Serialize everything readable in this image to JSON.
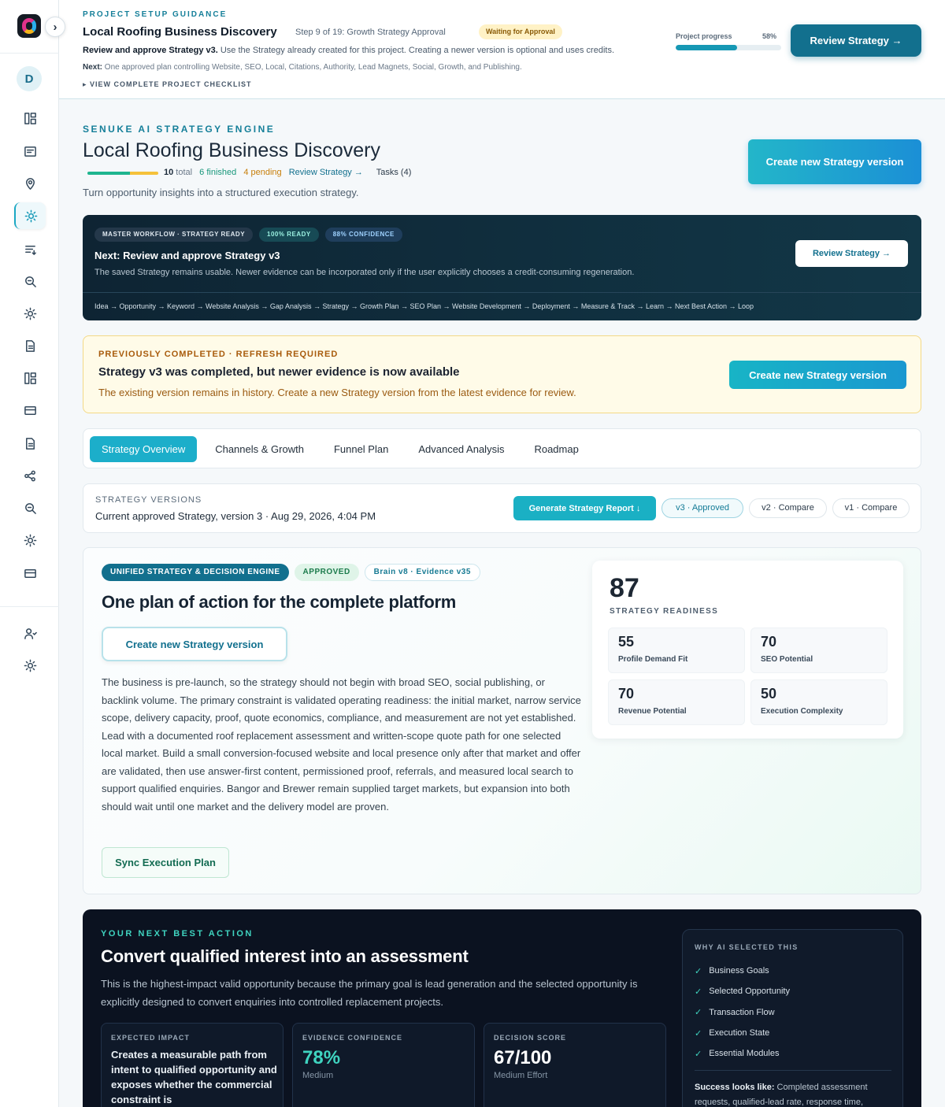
{
  "sidebar": {
    "avatar_initial": "D",
    "collapse_icon": "chevron-right-icon",
    "nav_icons": [
      "dashboard-icon",
      "card-icon",
      "location-pin-icon",
      "sun-icon",
      "list-filter-icon",
      "search-zoom-icon",
      "sun-icon",
      "document-icon",
      "dashboard-icon",
      "credit-card-icon",
      "document-icon",
      "share-nodes-icon",
      "search-zoom-icon",
      "sun-icon",
      "credit-card-icon",
      "users-icon",
      "sun-icon"
    ],
    "active_index": 3
  },
  "topbar": {
    "eyebrow": "PROJECT SETUP GUIDANCE",
    "title": "Local Roofing Business Discovery",
    "step": "Step 9 of 19: Growth Strategy Approval",
    "badge": "Waiting for Approval",
    "desc_bold": "Review and approve Strategy v3.",
    "desc_rest": " Use the Strategy already created for this project. Creating a newer version is optional and uses credits.",
    "next_label": "Next:",
    "next_text": " One approved plan controlling Website, SEO, Local, Citations, Authority, Lead Magnets, Social, Growth, and Publishing.",
    "checklist": "▸ VIEW COMPLETE PROJECT CHECKLIST",
    "progress_label": "Project progress",
    "progress_value": "58%",
    "progress_fraction": 0.58,
    "review_button": "Review Strategy →"
  },
  "header": {
    "eyebrow": "SENUKE AI STRATEGY ENGINE",
    "title": "Local Roofing Business Discovery",
    "total_num": "10",
    "total_label": " total",
    "finished": "6 finished",
    "pending": "4 pending",
    "review_link": "Review Strategy →",
    "tasks": "Tasks (4)",
    "subtitle": "Turn opportunity insights into a structured execution strategy.",
    "create_button": "Create new Strategy version"
  },
  "workflow": {
    "chips": [
      "MASTER WORKFLOW · STRATEGY READY",
      "100% READY",
      "88% CONFIDENCE"
    ],
    "title": "Next: Review and approve Strategy v3",
    "desc": "The saved Strategy remains usable. Newer evidence can be incorporated only if the user explicitly chooses a credit-consuming regeneration.",
    "path": "Idea → Opportunity → Keyword → Website Analysis → Gap Analysis → Strategy → Growth Plan → SEO Plan → Website Development → Deployment → Measure & Track → Learn → Next Best Action → Loop",
    "review_button": "Review Strategy →"
  },
  "refresh": {
    "eyebrow": "PREVIOUSLY COMPLETED · REFRESH REQUIRED",
    "title": "Strategy v3 was completed, but newer evidence is now available",
    "desc": "The existing version remains in history. Create a new Strategy version from the latest evidence for review.",
    "button": "Create new Strategy version"
  },
  "tabs": [
    "Strategy Overview",
    "Channels & Growth",
    "Funnel Plan",
    "Advanced Analysis",
    "Roadmap"
  ],
  "versions": {
    "eyebrow": "STRATEGY VERSIONS",
    "current": "Current approved Strategy, version 3 · Aug 29, 2026, 4:04 PM",
    "generate_button": "Generate Strategy Report ↓",
    "v3": "v3 · Approved",
    "v2": "v2 · Compare",
    "v1": "v1 · Compare"
  },
  "strategy": {
    "chips": [
      "UNIFIED STRATEGY & DECISION ENGINE",
      "APPROVED",
      "Brain v8 · Evidence v35"
    ],
    "title": "One plan of action for the complete platform",
    "create_button": "Create new Strategy version",
    "paragraph": "The business is pre-launch, so the strategy should not begin with broad SEO, social publishing, or backlink volume. The primary constraint is validated operating readiness: the initial market, narrow service scope, delivery capacity, proof, quote economics, compliance, and measurement are not yet established. Lead with a documented roof replacement assessment and written-scope quote path for one selected local market. Build a small conversion-focused website and local presence only after that market and offer are validated, then use answer-first content, permissioned proof, referrals, and measured local search to support qualified enquiries. Bangor and Brewer remain supplied target markets, but expansion into both should wait until one market and the delivery model are proven.",
    "sync_button": "Sync Execution Plan",
    "readiness_value": "87",
    "readiness_label": "STRATEGY READINESS",
    "metrics": [
      {
        "value": "55",
        "label": "Profile Demand Fit"
      },
      {
        "value": "70",
        "label": "SEO Potential"
      },
      {
        "value": "70",
        "label": "Revenue Potential"
      },
      {
        "value": "50",
        "label": "Execution Complexity"
      }
    ]
  },
  "next_action": {
    "eyebrow": "YOUR NEXT BEST ACTION",
    "title": "Convert qualified interest into an assessment",
    "desc": "This is the highest-impact valid opportunity because the primary goal is lead generation and the selected opportunity is explicitly designed to convert enquiries into controlled replacement projects.",
    "impact_label": "EXPECTED IMPACT",
    "impact_text": "Creates a measurable path from intent to qualified opportunity and exposes whether the commercial constraint is",
    "confidence_label": "EVIDENCE CONFIDENCE",
    "confidence_value": "78%",
    "confidence_sub": "Medium",
    "score_label": "DECISION SCORE",
    "score_value": "67/100",
    "score_sub": "Medium Effort",
    "why_eyebrow": "WHY AI SELECTED THIS",
    "why_items": [
      "Business Goals",
      "Selected Opportunity",
      "Transaction Flow",
      "Execution State",
      "Essential Modules"
    ],
    "success_label": "Success looks like:",
    "success_text": " Completed assessment requests, qualified-lead rate, response time,"
  },
  "colors": {
    "accent": "#1caeca",
    "primary_dark": "#12708e",
    "warning_text": "#a85b0c",
    "success": "#1c7b4c",
    "dark_bg": "#0b1220"
  }
}
